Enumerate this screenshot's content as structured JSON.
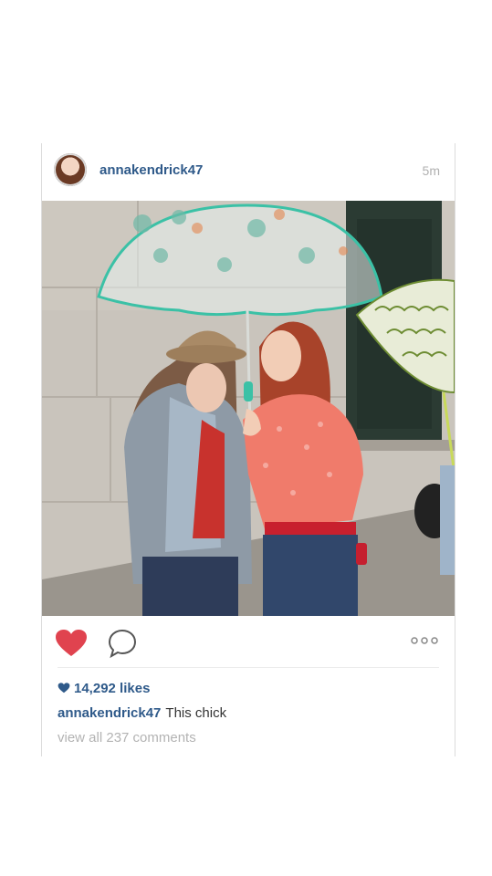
{
  "post": {
    "username": "annakendrick47",
    "time_ago": "5m",
    "likes_text": "14,292 likes",
    "caption_text": "This chick",
    "comments_link": "view all 237 comments"
  },
  "icons": {
    "like": "heart-filled-icon",
    "comment": "speech-bubble-icon",
    "more": "more-dots-icon"
  },
  "colors": {
    "username": "#2f5a8a",
    "heart": "#e0434f",
    "muted": "#b0b0b0"
  }
}
